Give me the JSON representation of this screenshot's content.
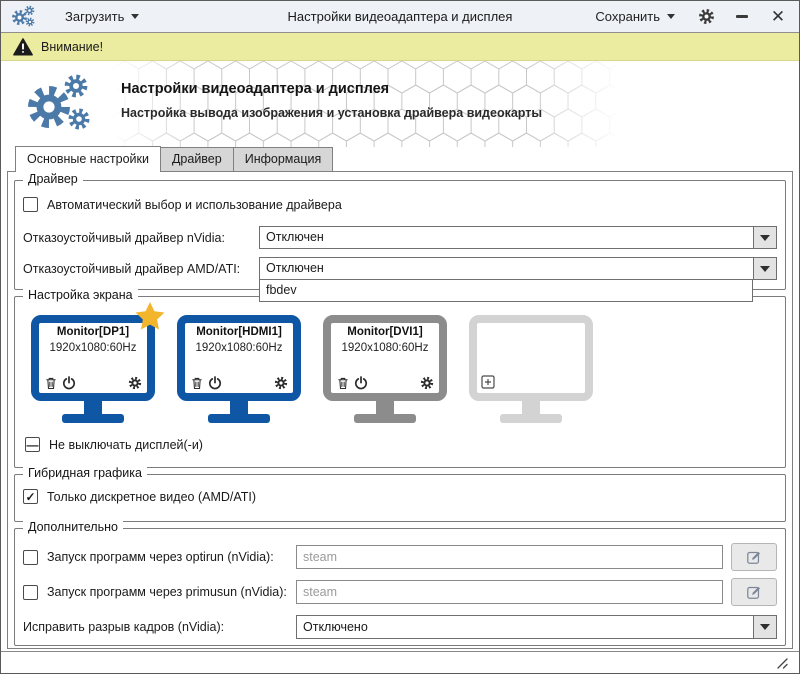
{
  "window": {
    "title": "Настройки видеоадаптера и дисплея",
    "load_button_label": "Загрузить",
    "save_button_label": "Сохранить"
  },
  "warning_bar": {
    "text": "Внимание!"
  },
  "header": {
    "title": "Настройки видеоадаптера и дисплея",
    "subtitle": "Настройка вывода изображения и установка драйвера видеокарты"
  },
  "tabs": [
    {
      "label": "Основные настройки",
      "active": true
    },
    {
      "label": "Драйвер",
      "active": false
    },
    {
      "label": "Информация",
      "active": false
    }
  ],
  "driver_group": {
    "legend": "Драйвер",
    "auto_driver_checkbox": {
      "label": "Автоматический выбор и использование драйвера",
      "state": "unchecked",
      "glyph": ""
    },
    "nvidia_failsafe": {
      "label": "Отказоустойчивый драйвер nVidia:",
      "value": "Отключен"
    },
    "amd_failsafe": {
      "label": "Отказоустойчивый драйвер AMD/ATI:",
      "value": "Отключен",
      "open_options": [
        "fbdev"
      ]
    }
  },
  "screen_group": {
    "legend": "Настройка экрана",
    "monitors": [
      {
        "name": "Monitor[DP1]",
        "resolution": "1920x1080:60Hz",
        "primary": true,
        "enabled": true
      },
      {
        "name": "Monitor[HDMI1]",
        "resolution": "1920x1080:60Hz",
        "primary": false,
        "enabled": true
      },
      {
        "name": "Monitor[DVI1]",
        "resolution": "1920x1080:60Hz",
        "primary": false,
        "enabled": false
      },
      {
        "name": "",
        "resolution": "",
        "empty_slot": true
      }
    ],
    "keep_on_checkbox": {
      "label": "Не выключать дисплей(-и)",
      "state": "indeterminate",
      "glyph": "—"
    }
  },
  "hybrid_group": {
    "legend": "Гибридная графика",
    "discrete_checkbox": {
      "label": "Только дискретное видео (AMD/ATI)",
      "state": "checked",
      "glyph": "✓"
    }
  },
  "extra_group": {
    "legend": "Дополнительно",
    "optirun": {
      "label": "Запуск программ через optirun (nVidia):",
      "state": "unchecked",
      "glyph": "",
      "value": "",
      "placeholder": "steam"
    },
    "primusun": {
      "label": "Запуск программ через primusun (nVidia):",
      "state": "unchecked",
      "glyph": "",
      "value": "",
      "placeholder": "steam"
    },
    "tearing": {
      "label": "Исправить разрыв кадров (nVidia):",
      "value": "Отключено"
    }
  },
  "colors": {
    "accent_blue": "#4b79a8",
    "monitor_active_blue": "#0f57a5",
    "monitor_inactive_gray": "#8c8c8c",
    "monitor_empty_gray": "#d3d3d3",
    "warning_bg": "#ececa0",
    "star_gold": "#f2b52c"
  }
}
